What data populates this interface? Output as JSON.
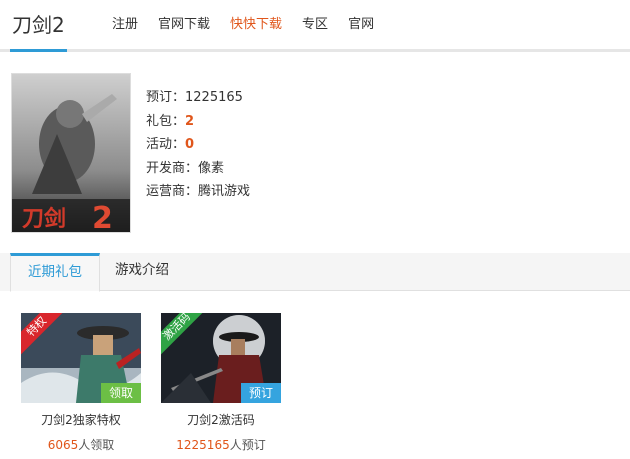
{
  "header": {
    "title": "刀剑2",
    "nav": [
      {
        "label": "注册",
        "hot": false
      },
      {
        "label": "官网下载",
        "hot": false
      },
      {
        "label": "快快下载",
        "hot": true
      },
      {
        "label": "专区",
        "hot": false
      },
      {
        "label": "官网",
        "hot": false
      }
    ]
  },
  "game": {
    "preorder_label": "预订：",
    "preorder_value": "1225165",
    "gift_label": "礼包：",
    "gift_value": "2",
    "event_label": "活动：",
    "event_value": "0",
    "developer_label": "开发商：",
    "developer_value": "像素",
    "publisher_label": "运营商：",
    "publisher_value": "腾讯游戏"
  },
  "tabs": [
    {
      "label": "近期礼包",
      "active": true
    },
    {
      "label": "游戏介绍",
      "active": false
    }
  ],
  "gifts": [
    {
      "ribbon": "特权",
      "action": "领取",
      "name": "刀剑2独家特权",
      "count": "6065",
      "count_suffix": "人领取"
    },
    {
      "ribbon": "激活码",
      "action": "预订",
      "name": "刀剑2激活码",
      "count": "1225165",
      "count_suffix": "人预订"
    }
  ],
  "colors": {
    "accent": "#2e9bd6",
    "highlight": "#e0561b",
    "claim_button": "#6cbf45",
    "preorder_button": "#35a4df"
  }
}
